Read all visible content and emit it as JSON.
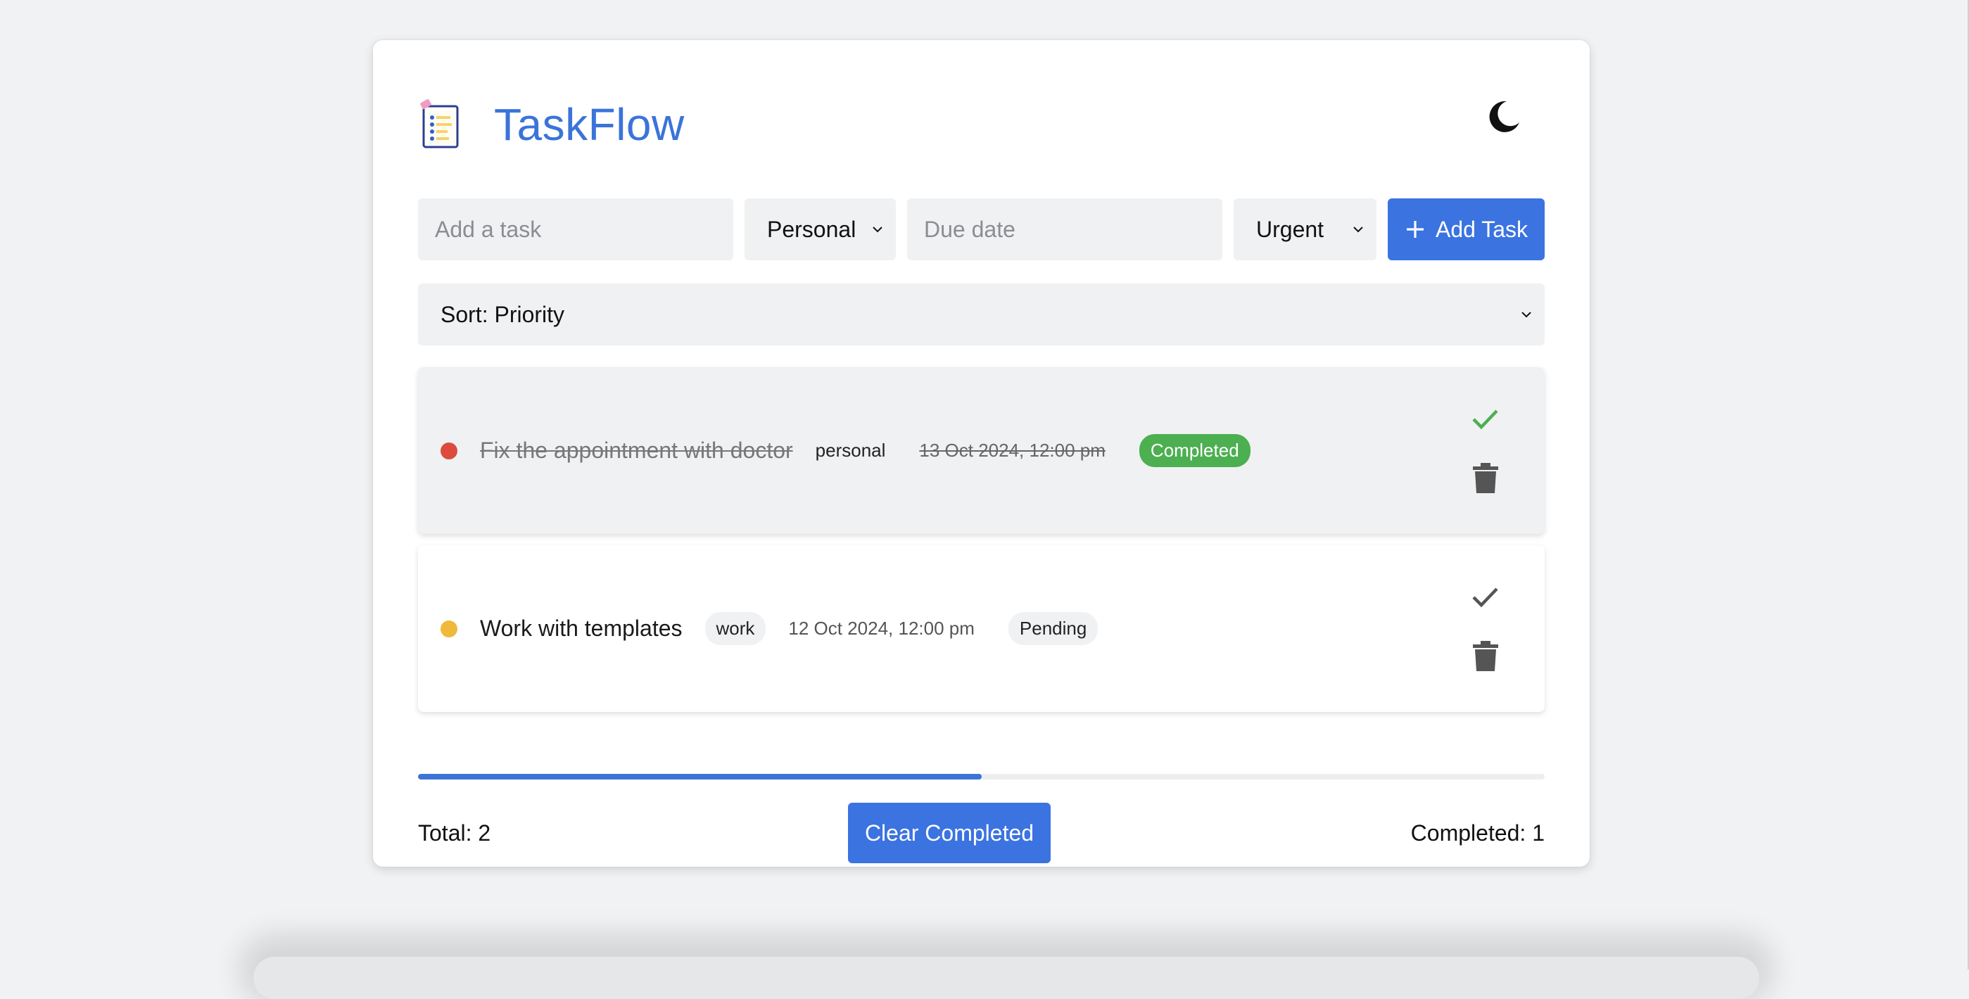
{
  "app": {
    "title": "TaskFlow",
    "logo_icon": "clipboard-checklist-icon",
    "theme_toggle_icon": "moon-icon"
  },
  "add_form": {
    "task_placeholder": "Add a task",
    "category_selected": "Personal",
    "due_placeholder": "Due date",
    "priority_selected": "Urgent",
    "add_button_label": "Add Task",
    "add_button_icon": "plus-icon"
  },
  "sort": {
    "selected": "Sort: Priority"
  },
  "tasks": [
    {
      "title": "Fix the appointment with doctor",
      "category": "personal",
      "due": "13 Oct 2024, 12:00 pm",
      "status": "Completed",
      "priority_color": "#dd4b3f",
      "completed": true
    },
    {
      "title": "Work with templates",
      "category": "work",
      "due": "12 Oct 2024, 12:00 pm",
      "status": "Pending",
      "priority_color": "#f0b93a",
      "completed": false
    }
  ],
  "progress": {
    "fraction": 0.5
  },
  "footer": {
    "total": "Total: 2",
    "clear_label": "Clear Completed",
    "completed": "Completed: 1"
  },
  "colors": {
    "accent": "#3b73e0",
    "completed_green": "#4caf50"
  }
}
